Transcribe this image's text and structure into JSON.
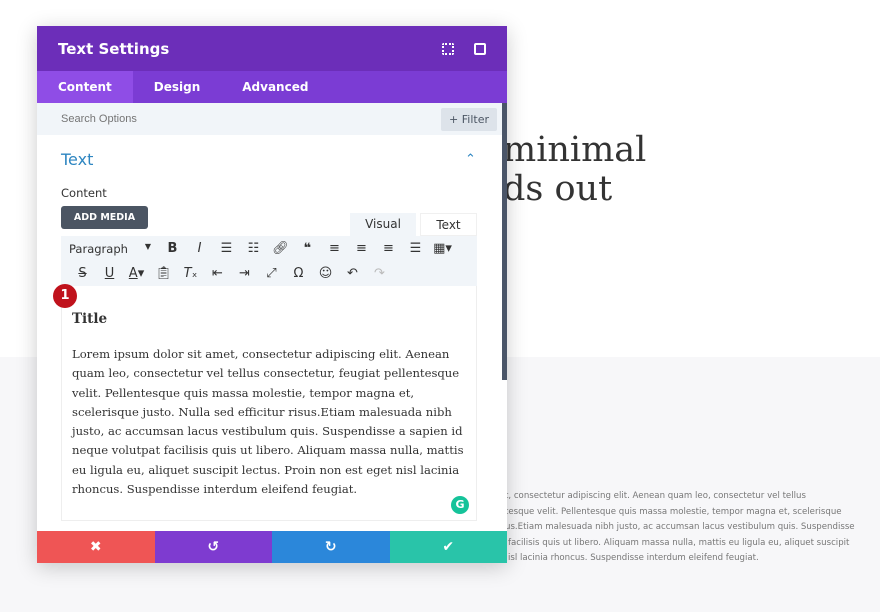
{
  "background": {
    "headline": [
      "minimal",
      "ds out"
    ],
    "body_lines": [
      "t, consectetur adipiscing elit. Aenean quam leo, consectetur vel tellus",
      "tesque velit. Pellentesque quis massa molestie, tempor magna et, scelerisque",
      "us.Etiam malesuada nibh justo, ac accumsan lacus vestibulum quis. Suspendisse",
      "facilisis quis ut libero. Aliquam massa nulla, mattis eu ligula eu, aliquet suscipit",
      "isl lacinia rhoncus. Suspendisse interdum eleifend feugiat."
    ]
  },
  "modal": {
    "title": "Text Settings",
    "tabs": [
      "Content",
      "Design",
      "Advanced"
    ],
    "search_placeholder": "Search Options",
    "filter_label": "+ Filter",
    "section_title": "Text",
    "content_label": "Content",
    "add_media": "ADD MEDIA",
    "editor_tabs": [
      "Visual",
      "Text"
    ],
    "format_select": "Paragraph",
    "badge": "1",
    "editor_title": "Title",
    "editor_body": "Lorem ipsum dolor sit amet, consectetur adipiscing elit. Aenean quam leo, consectetur vel tellus consectetur, feugiat pellentesque velit. Pellentesque quis massa molestie, tempor magna et, scelerisque justo. Nulla sed efficitur risus.Etiam malesuada nibh justo, ac accumsan lacus vestibulum quis. Suspendisse a sapien id neque volutpat facilisis quis ut libero. Aliquam massa nulla, mattis eu ligula eu, aliquet suscipit lectus. Proin non est eget nisl lacinia rhoncus. Suspendisse interdum eleifend feugiat.",
    "grammarly": "G"
  },
  "colors": {
    "header": "#6c2eb9",
    "tabs": "#7b3cd4",
    "cancel": "#ef5555",
    "reset": "#7e3bd0",
    "redo": "#2b87da",
    "save": "#29c4a9"
  }
}
